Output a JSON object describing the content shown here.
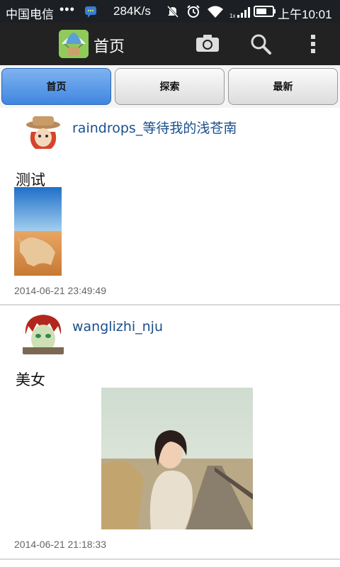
{
  "status_bar": {
    "carrier": "中国电信",
    "dots": "•••",
    "speed": "284K/s",
    "time": "上午10:01",
    "icons": [
      "message-icon",
      "mute-icon",
      "alarm-icon",
      "wifi-icon",
      "signal-icon",
      "battery-icon"
    ]
  },
  "action_bar": {
    "title": "首页",
    "icons": [
      "app-icon",
      "camera-icon",
      "search-icon",
      "overflow-menu-icon"
    ]
  },
  "tabs": [
    {
      "label": "首页",
      "active": true
    },
    {
      "label": "探索",
      "active": false
    },
    {
      "label": "最新",
      "active": false
    }
  ],
  "posts": [
    {
      "username": "raindrops_等待我的浅苍南",
      "text": "测试",
      "timestamp": "2014-06-21 23:49:49",
      "image": "desert-fox-photo"
    },
    {
      "username": "wanglizhi_nju",
      "text": "美女",
      "timestamp": "2014-06-21 21:18:33",
      "image": "woman-on-boardwalk-photo"
    }
  ],
  "colors": {
    "status_bar": "#1c1f24",
    "action_bar": "#222222",
    "active_tab": "#4a8ee6",
    "username": "#1a4f8c"
  }
}
